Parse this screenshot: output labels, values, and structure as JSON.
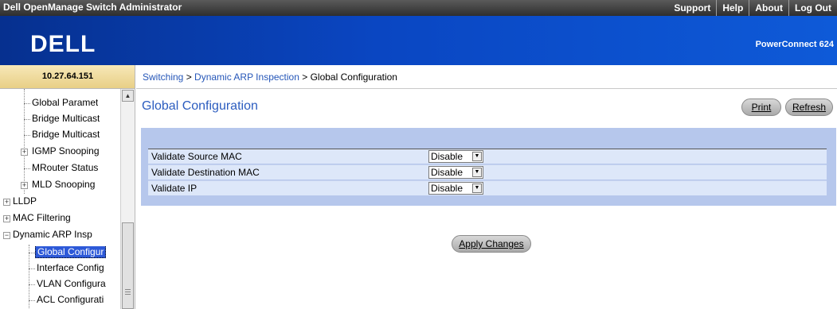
{
  "header": {
    "app_title": "Dell OpenManage Switch Administrator",
    "links": [
      "Support",
      "Help",
      "About",
      "Log Out"
    ]
  },
  "banner": {
    "logo": "DELL",
    "product": "PowerConnect 624"
  },
  "ip": "10.27.64.151",
  "breadcrumb": {
    "switching": "Switching",
    "sep1": " > ",
    "dai": "Dynamic ARP Inspection",
    "sep2": " > ",
    "current": "Global Configuration"
  },
  "tree": {
    "items": [
      "Global Paramet",
      "Bridge Multicast",
      "Bridge Multicast",
      "IGMP Snooping",
      "MRouter Status",
      "MLD Snooping",
      "LLDP",
      "MAC Filtering",
      "Dynamic ARP Insp",
      "Global Configur",
      "Interface Config",
      "VLAN Configura",
      "ACL Configurati"
    ]
  },
  "page_title": "Global Configuration",
  "buttons": {
    "print": "Print",
    "refresh": "Refresh",
    "apply": "Apply Changes"
  },
  "config": {
    "rows": [
      {
        "label": "Validate Source MAC",
        "value": "Disable"
      },
      {
        "label": "Validate Destination MAC",
        "value": "Disable"
      },
      {
        "label": "Validate IP",
        "value": "Disable"
      }
    ]
  },
  "colors": {
    "banner": "#0a46c2",
    "title": "#2b5cbf",
    "panel": "#b6c7ec",
    "row": "#dde7f9"
  }
}
